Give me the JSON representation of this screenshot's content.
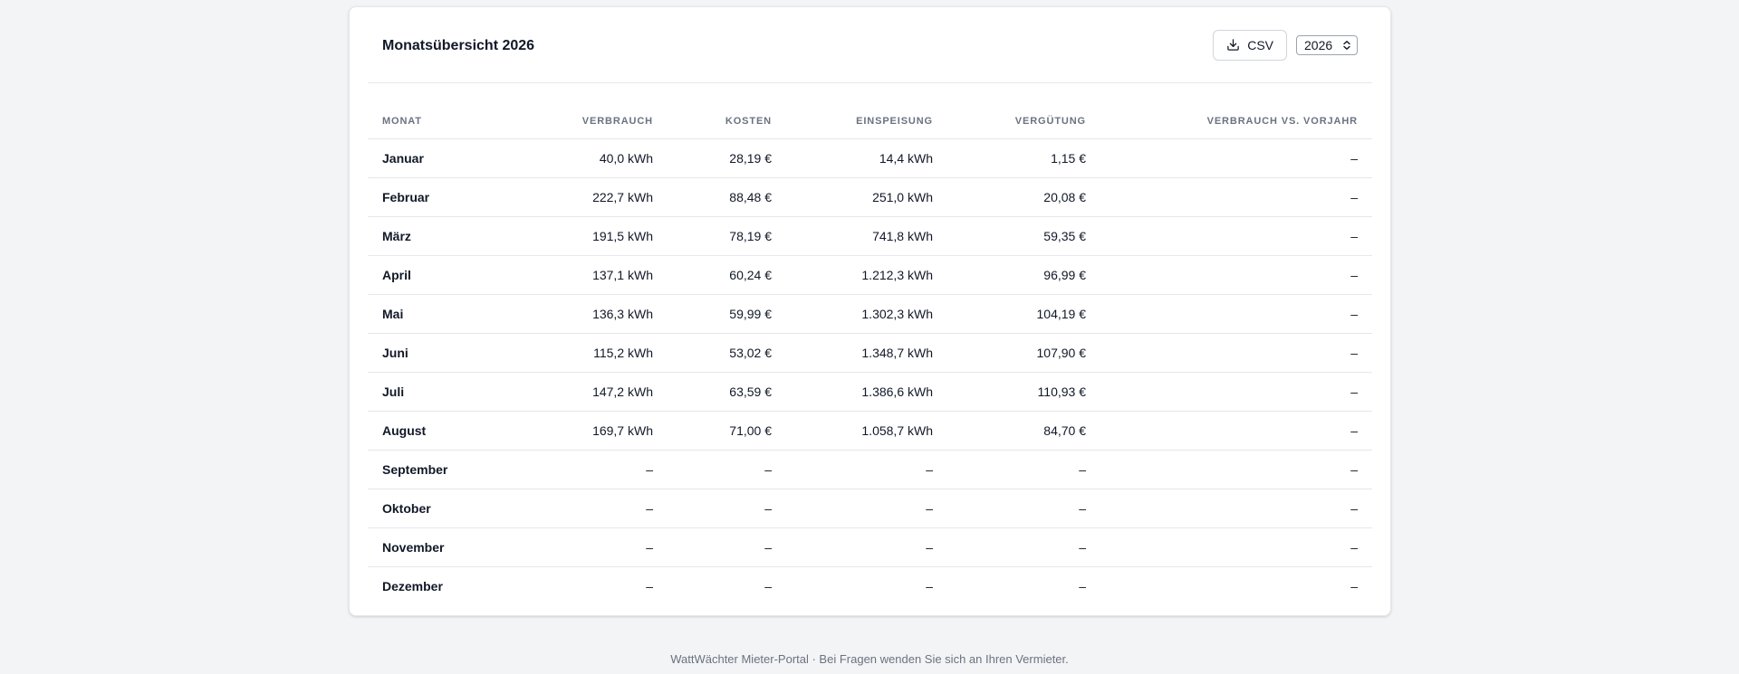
{
  "card": {
    "title": "Monatsübersicht 2026",
    "csv_button_label": "CSV",
    "year_select_value": "2026"
  },
  "table": {
    "headers": {
      "month": "Monat",
      "verbrauch": "Verbrauch",
      "kosten": "Kosten",
      "einspeisung": "Einspeisung",
      "verguetung": "Vergütung",
      "vorjahr": "Verbrauch vs. Vorjahr"
    },
    "rows": [
      {
        "month": "Januar",
        "verbrauch": "40,0 kWh",
        "kosten": "28,19 €",
        "einspeisung": "14,4 kWh",
        "verguetung": "1,15 €",
        "vorjahr": "–"
      },
      {
        "month": "Februar",
        "verbrauch": "222,7 kWh",
        "kosten": "88,48 €",
        "einspeisung": "251,0 kWh",
        "verguetung": "20,08 €",
        "vorjahr": "–"
      },
      {
        "month": "März",
        "verbrauch": "191,5 kWh",
        "kosten": "78,19 €",
        "einspeisung": "741,8 kWh",
        "verguetung": "59,35 €",
        "vorjahr": "–"
      },
      {
        "month": "April",
        "verbrauch": "137,1 kWh",
        "kosten": "60,24 €",
        "einspeisung": "1.212,3 kWh",
        "verguetung": "96,99 €",
        "vorjahr": "–"
      },
      {
        "month": "Mai",
        "verbrauch": "136,3 kWh",
        "kosten": "59,99 €",
        "einspeisung": "1.302,3 kWh",
        "verguetung": "104,19 €",
        "vorjahr": "–"
      },
      {
        "month": "Juni",
        "verbrauch": "115,2 kWh",
        "kosten": "53,02 €",
        "einspeisung": "1.348,7 kWh",
        "verguetung": "107,90 €",
        "vorjahr": "–"
      },
      {
        "month": "Juli",
        "verbrauch": "147,2 kWh",
        "kosten": "63,59 €",
        "einspeisung": "1.386,6 kWh",
        "verguetung": "110,93 €",
        "vorjahr": "–"
      },
      {
        "month": "August",
        "verbrauch": "169,7 kWh",
        "kosten": "71,00 €",
        "einspeisung": "1.058,7 kWh",
        "verguetung": "84,70 €",
        "vorjahr": "–"
      },
      {
        "month": "September",
        "verbrauch": "–",
        "kosten": "–",
        "einspeisung": "–",
        "verguetung": "–",
        "vorjahr": "–"
      },
      {
        "month": "Oktober",
        "verbrauch": "–",
        "kosten": "–",
        "einspeisung": "–",
        "verguetung": "–",
        "vorjahr": "–"
      },
      {
        "month": "November",
        "verbrauch": "–",
        "kosten": "–",
        "einspeisung": "–",
        "verguetung": "–",
        "vorjahr": "–"
      },
      {
        "month": "Dezember",
        "verbrauch": "–",
        "kosten": "–",
        "einspeisung": "–",
        "verguetung": "–",
        "vorjahr": "–"
      }
    ]
  },
  "footer": {
    "text": "WattWächter Mieter-Portal · Bei Fragen wenden Sie sich an Ihren Vermieter."
  },
  "icons": {
    "csv_button": "download-icon",
    "year_select": "chevron-up-down-icon"
  }
}
